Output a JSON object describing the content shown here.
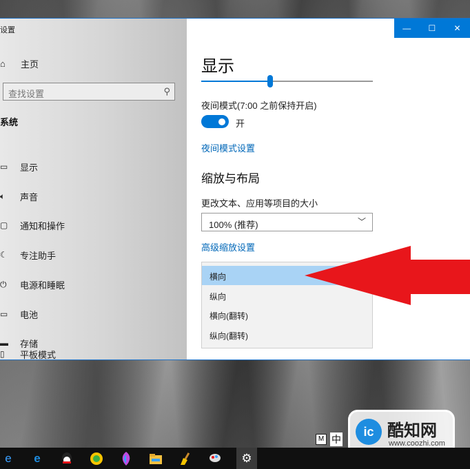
{
  "window": {
    "title": "设置",
    "controls": {
      "minimize": "—",
      "maximize": "☐",
      "close": "✕"
    }
  },
  "sidebar": {
    "home": {
      "label": "主页",
      "icon": "home-icon"
    },
    "search": {
      "placeholder": "查找设置",
      "icon": "search-icon"
    },
    "section": "系统",
    "items": [
      {
        "label": "显示",
        "icon": "monitor-icon"
      },
      {
        "label": "声音",
        "icon": "speaker-icon"
      },
      {
        "label": "通知和操作",
        "icon": "notification-icon"
      },
      {
        "label": "专注助手",
        "icon": "moon-icon"
      },
      {
        "label": "电源和睡眠",
        "icon": "power-icon"
      },
      {
        "label": "电池",
        "icon": "battery-icon"
      },
      {
        "label": "存储",
        "icon": "storage-icon"
      },
      {
        "label": "平板模式",
        "icon": "tablet-icon"
      }
    ]
  },
  "content": {
    "title": "显示",
    "brightness_level": 0.4,
    "night_mode": {
      "label": "夜间模式(7:00 之前保持开启)",
      "state": "开",
      "on": true
    },
    "night_settings_link": "夜间模式设置",
    "scale_heading": "缩放与布局",
    "size_label": "更改文本、应用等项目的大小",
    "size_value": "100% (推荐)",
    "advanced_link": "高级缩放设置",
    "orientation_options": [
      "横向",
      "纵向",
      "横向(翻转)",
      "纵向(翻转)"
    ],
    "selected_option": 0
  },
  "taskbar": {
    "icons": [
      "ie-icon",
      "edge-icon",
      "qq-icon",
      "browser-icon",
      "paint-icon",
      "file-explorer-icon",
      "broom-icon",
      "brush-icon",
      "settings-icon"
    ],
    "ime": {
      "mode": "M",
      "lang": "中"
    }
  },
  "watermark": {
    "name": "酷知网",
    "url": "www.coozhi.com",
    "logo_text": "ic"
  },
  "colors": {
    "accent": "#0078d7",
    "arrow": "#e8161b",
    "selected_option": "#a9d3f5"
  }
}
